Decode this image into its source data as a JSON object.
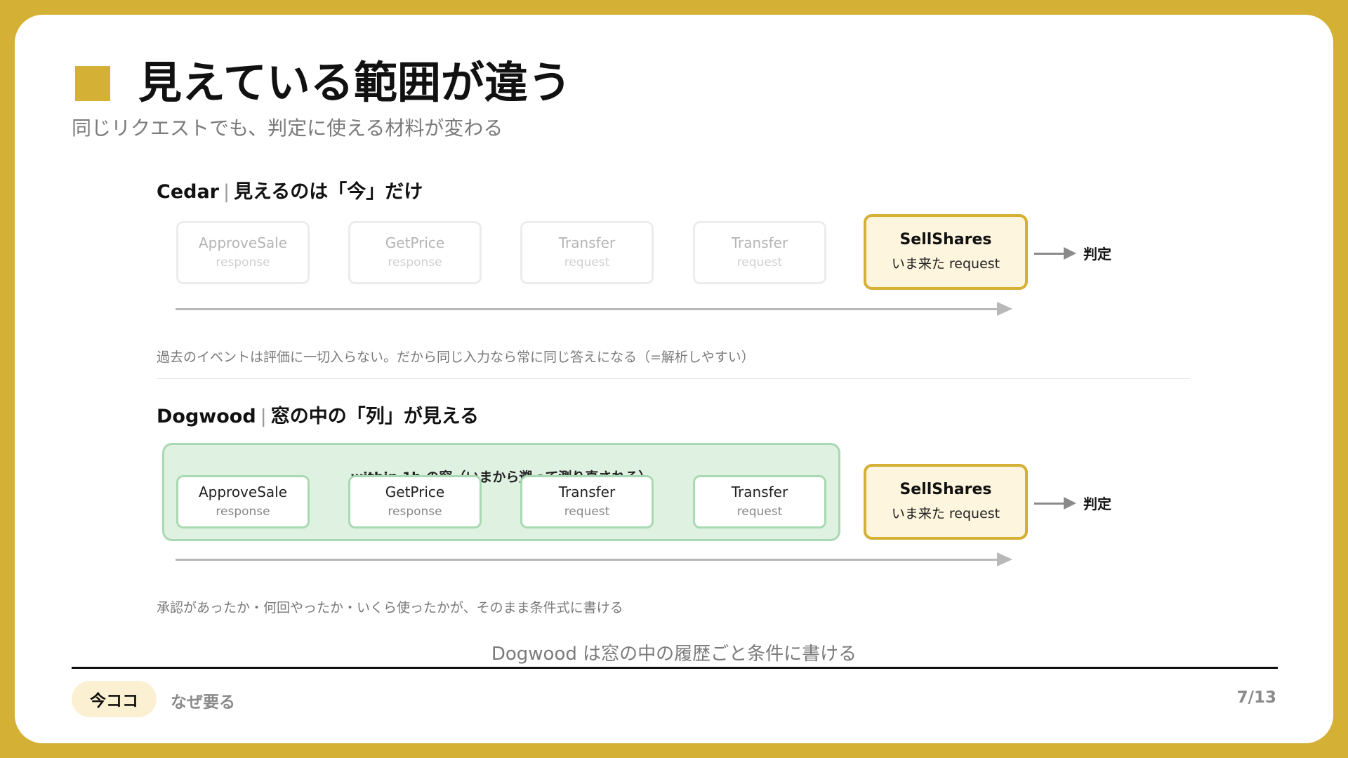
{
  "title": "見えている範囲が違う",
  "subtitle": "同じリクエストでも、判定に使える材料が変わる",
  "cedar": {
    "heading_name": "Cedar",
    "heading_separator": "|",
    "heading_text": "見えるのは「今」だけ",
    "events": [
      {
        "name": "ApproveSale",
        "kind": "response"
      },
      {
        "name": "GetPrice",
        "kind": "response"
      },
      {
        "name": "Transfer",
        "kind": "request"
      },
      {
        "name": "Transfer",
        "kind": "request"
      }
    ],
    "current": {
      "name": "SellShares",
      "kind": "いま来た request"
    },
    "decision": "判定",
    "note": "過去のイベントは評価に一切入らない。だから同じ入力なら常に同じ答えになる（=解析しやすい）"
  },
  "dogwood": {
    "heading_name": "Dogwood",
    "heading_separator": "|",
    "heading_text": "窓の中の「列」が見える",
    "window_label": "within 1h の窓（いまから遡って測り直される）",
    "events": [
      {
        "name": "ApproveSale",
        "kind": "response"
      },
      {
        "name": "GetPrice",
        "kind": "response"
      },
      {
        "name": "Transfer",
        "kind": "request"
      },
      {
        "name": "Transfer",
        "kind": "request"
      }
    ],
    "current": {
      "name": "SellShares",
      "kind": "いま来た request"
    },
    "decision": "判定",
    "note": "承認があったか・何回やったか・いくら使ったかが、そのまま条件式に書ける"
  },
  "conclusion": "Dogwood は窓の中の履歴ごと条件に書ける",
  "footer": {
    "current_label": "今ココ",
    "next_label": "なぜ要る",
    "page": "7/13"
  },
  "colors": {
    "frame": "#d4b035",
    "accent": "#d4b035",
    "current_bg": "#fdf5dd",
    "window_bg": "#dff1e1",
    "window_border": "#a9d9b2"
  }
}
